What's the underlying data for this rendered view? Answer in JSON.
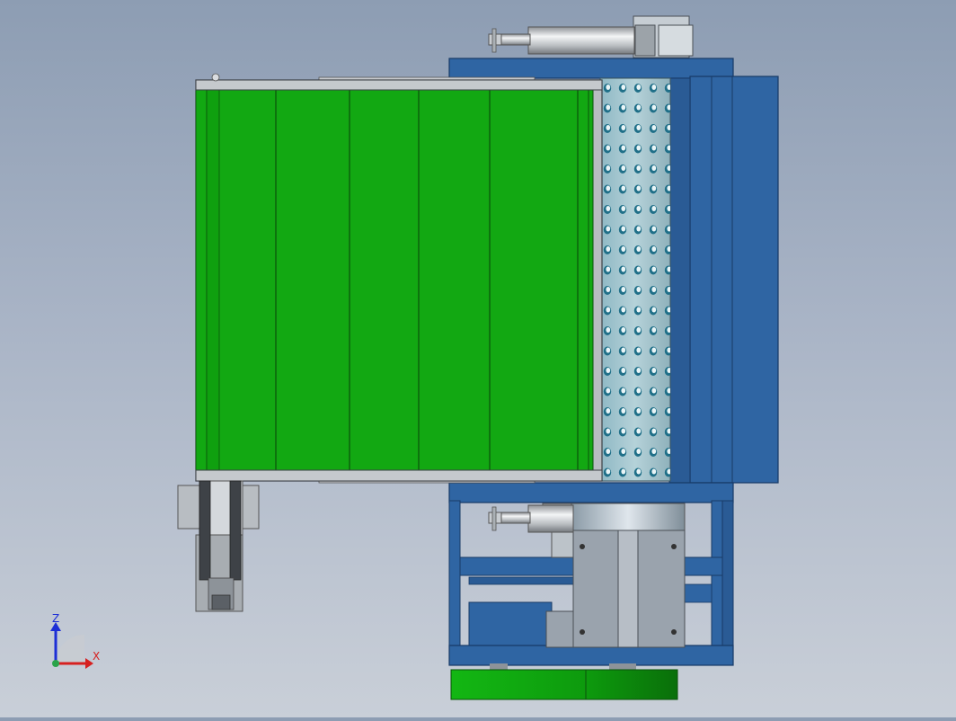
{
  "viewport": {
    "background_top": "#8d9db3",
    "background_bottom": "#c9cfd8"
  },
  "model": {
    "frame_color": "#2f65a3",
    "frame_dark": "#1f4a7e",
    "belt_color": "#0fa60f",
    "belt_dark": "#0a7a0a",
    "steel_color": "#a4a8ad",
    "perforated_color": "#9cc2cc"
  },
  "triad": {
    "z_label": "Z",
    "x_label": "X",
    "z_color": "#1d2fd6",
    "x_color": "#d62020"
  }
}
